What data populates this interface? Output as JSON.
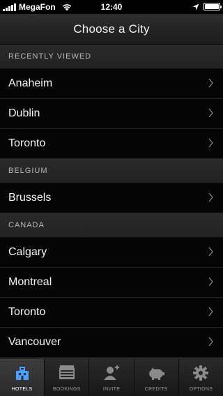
{
  "status_bar": {
    "carrier": "MegaFon",
    "time": "12:40"
  },
  "nav": {
    "title": "Choose a City"
  },
  "sections": [
    {
      "header": "RECENTLY VIEWED",
      "cities": [
        "Anaheim",
        "Dublin",
        "Toronto"
      ]
    },
    {
      "header": "BELGIUM",
      "cities": [
        "Brussels"
      ]
    },
    {
      "header": "CANADA",
      "cities": [
        "Calgary",
        "Montreal",
        "Toronto",
        "Vancouver"
      ]
    }
  ],
  "tabs": [
    {
      "label": "HOTELS",
      "icon": "hotel-icon",
      "active": true
    },
    {
      "label": "BOOKINGS",
      "icon": "bookings-icon",
      "active": false
    },
    {
      "label": "INVITE",
      "icon": "invite-icon",
      "active": false
    },
    {
      "label": "CREDITS",
      "icon": "piggy-bank-icon",
      "active": false
    },
    {
      "label": "OPTIONS",
      "icon": "gear-icon",
      "active": false
    }
  ],
  "colors": {
    "background": "#000000",
    "section_header": "#262626",
    "active_tab_icon": "#4a9fff"
  }
}
